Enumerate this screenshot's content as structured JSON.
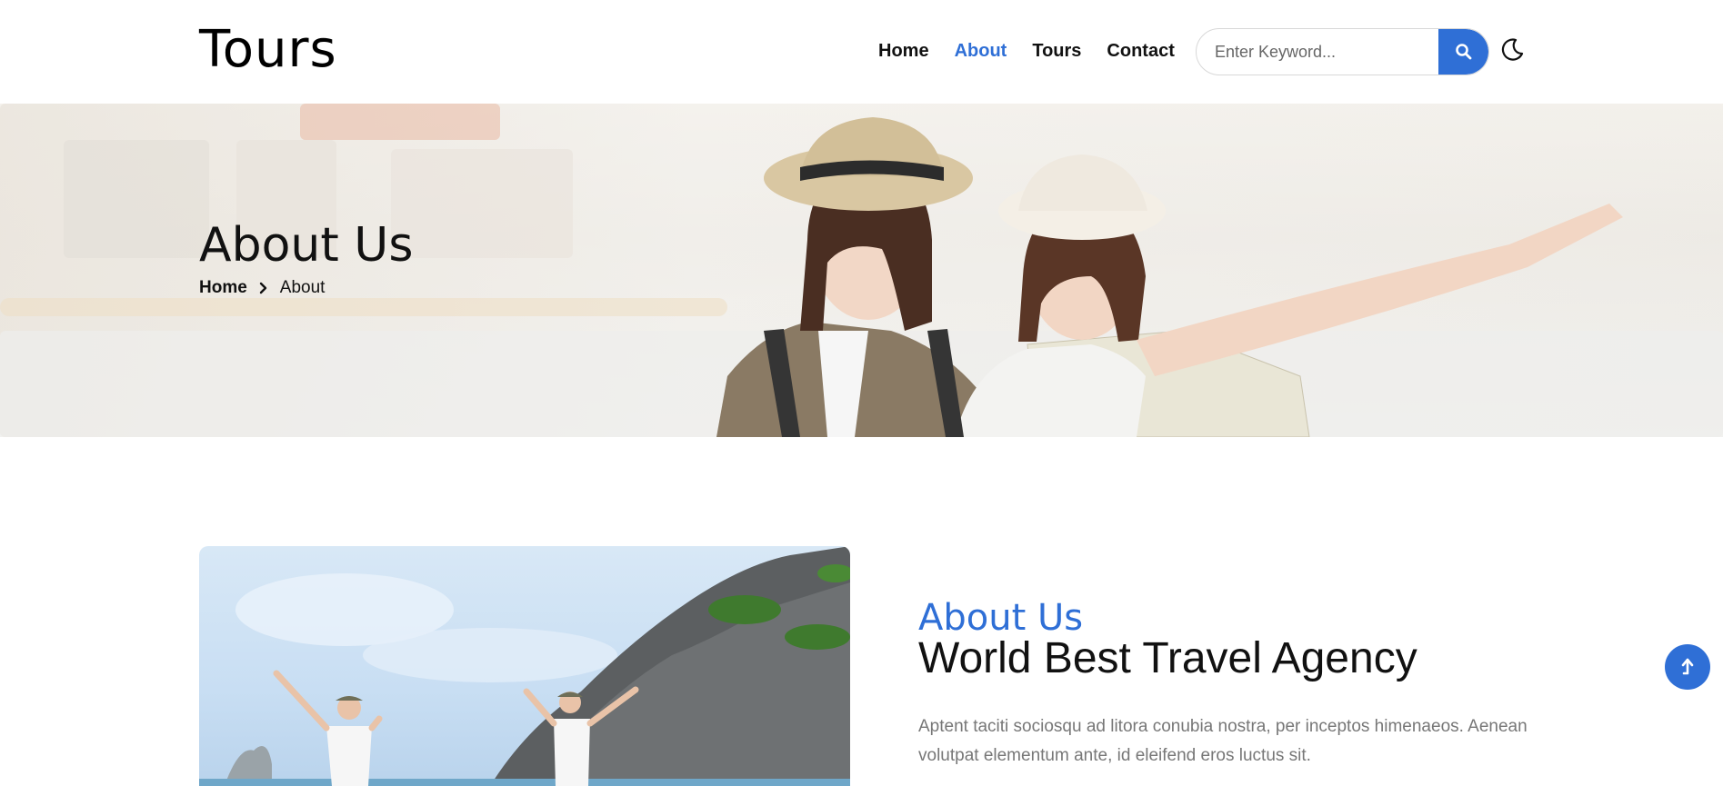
{
  "header": {
    "logo": "Tours",
    "nav": [
      {
        "label": "Home",
        "active": false
      },
      {
        "label": "About",
        "active": true
      },
      {
        "label": "Tours",
        "active": false
      },
      {
        "label": "Contact",
        "active": false
      }
    ],
    "search": {
      "placeholder": "Enter Keyword...",
      "icon": "search-icon"
    },
    "theme_toggle_icon": "moon-icon"
  },
  "hero": {
    "title": "About Us",
    "breadcrumb": {
      "home": "Home",
      "separator_icon": "chevron-right-icon",
      "current": "About"
    }
  },
  "about": {
    "kicker": "About Us",
    "heading": "World Best Travel Agency",
    "paragraph": "Aptent taciti sociosqu ad litora conubia nostra, per inceptos himenaeos. Aenean volutpat elementum ante, id eleifend eros luctus sit."
  },
  "back_to_top_icon": "arrow-up-icon",
  "colors": {
    "accent": "#2f6fd6",
    "text": "#111111",
    "muted": "#777777"
  }
}
